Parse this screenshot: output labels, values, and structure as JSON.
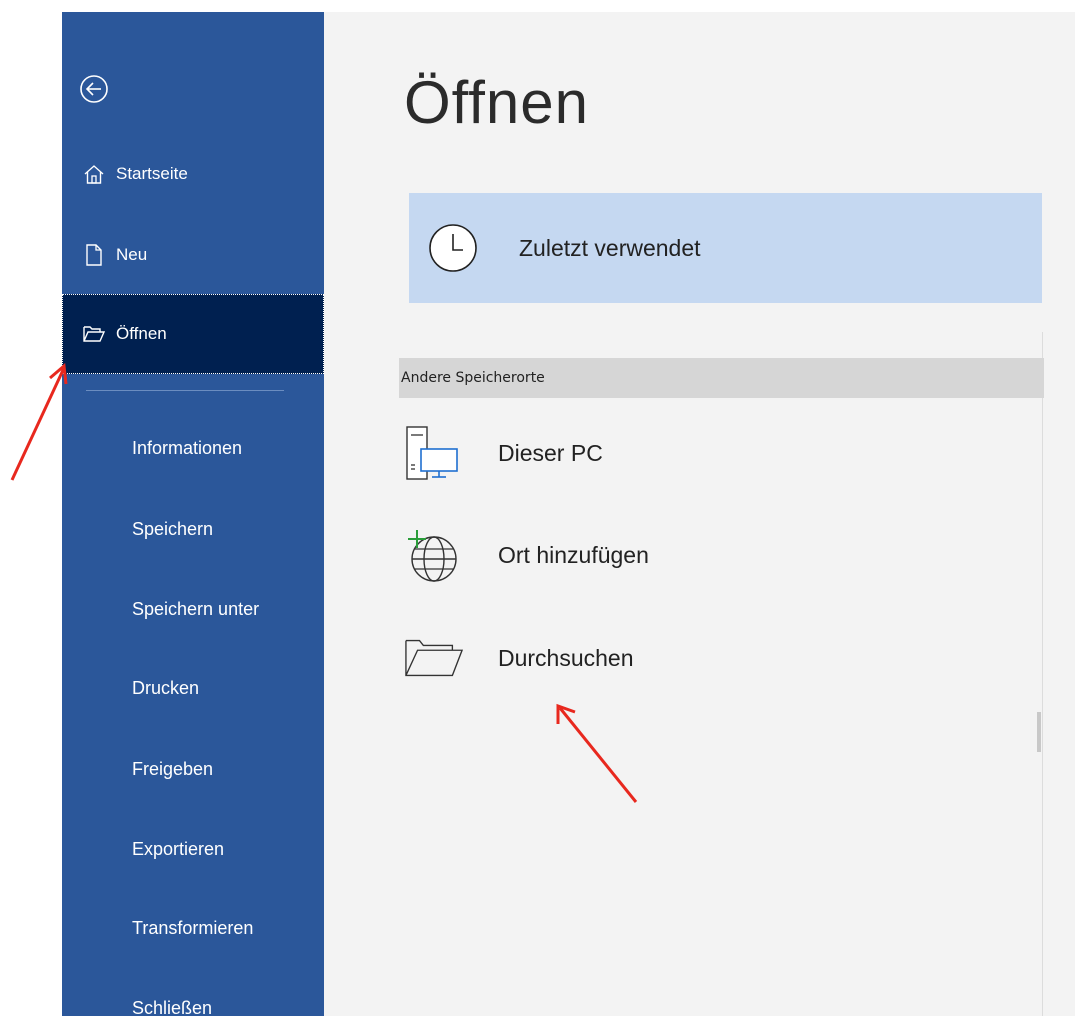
{
  "sidebar": {
    "background_color": "#2b579a",
    "selected_color": "#002050",
    "back_icon": "back-arrow-circle-icon",
    "top_items": [
      {
        "label": "Startseite",
        "icon": "home-icon"
      },
      {
        "label": "Neu",
        "icon": "new-document-icon"
      },
      {
        "label": "Öffnen",
        "icon": "open-folder-icon",
        "selected": true
      }
    ],
    "text_items": [
      {
        "label": "Informationen"
      },
      {
        "label": "Speichern"
      },
      {
        "label": "Speichern unter"
      },
      {
        "label": "Drucken"
      },
      {
        "label": "Freigeben"
      },
      {
        "label": "Exportieren"
      },
      {
        "label": "Transformieren"
      },
      {
        "label": "Schließen"
      }
    ]
  },
  "main": {
    "title": "Öffnen",
    "background_color": "#f3f3f3",
    "recent": {
      "label": "Zuletzt verwendet",
      "icon": "clock-icon",
      "highlight_color": "#c5d8f1"
    },
    "section_header": "Andere Speicherorte",
    "locations": [
      {
        "label": "Dieser PC",
        "icon": "this-pc-icon"
      },
      {
        "label": "Ort hinzufügen",
        "icon": "add-place-globe-icon"
      },
      {
        "label": "Durchsuchen",
        "icon": "browse-folder-icon"
      }
    ]
  },
  "annotations": {
    "arrow_color": "#e8281e"
  }
}
